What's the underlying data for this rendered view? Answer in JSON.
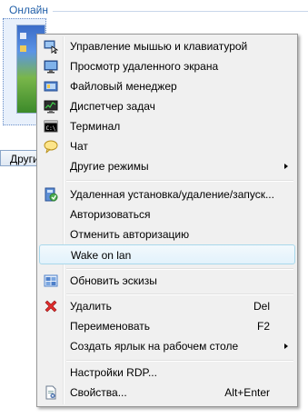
{
  "background": {
    "group_label": "Онлайн",
    "button_label": "Други"
  },
  "menu": {
    "items": [
      {
        "label": "Управление мышью и клавиатурой",
        "icon": "mouse-keyboard-icon"
      },
      {
        "label": "Просмотр удаленного экрана",
        "icon": "remote-screen-icon"
      },
      {
        "label": "Файловый менеджер",
        "icon": "file-manager-icon"
      },
      {
        "label": "Диспетчер задач",
        "icon": "task-manager-icon"
      },
      {
        "label": "Терминал",
        "icon": "terminal-icon"
      },
      {
        "label": "Чат",
        "icon": "chat-icon"
      },
      {
        "label": "Другие режимы",
        "submenu": true
      },
      {
        "label": "Удаленная установка/удаление/запуск...",
        "icon": "remote-install-icon"
      },
      {
        "label": "Авторизоваться"
      },
      {
        "label": "Отменить авторизацию"
      },
      {
        "label": "Wake on lan",
        "highlighted": true
      },
      {
        "label": "Обновить эскизы",
        "icon": "refresh-thumbnails-icon"
      },
      {
        "label": "Удалить",
        "icon": "delete-icon",
        "shortcut": "Del"
      },
      {
        "label": "Переименовать",
        "shortcut": "F2"
      },
      {
        "label": "Создать ярлык на рабочем столе",
        "submenu": true
      },
      {
        "label": "Настройки RDP..."
      },
      {
        "label": "Свойства...",
        "icon": "properties-icon",
        "shortcut": "Alt+Enter"
      }
    ]
  }
}
